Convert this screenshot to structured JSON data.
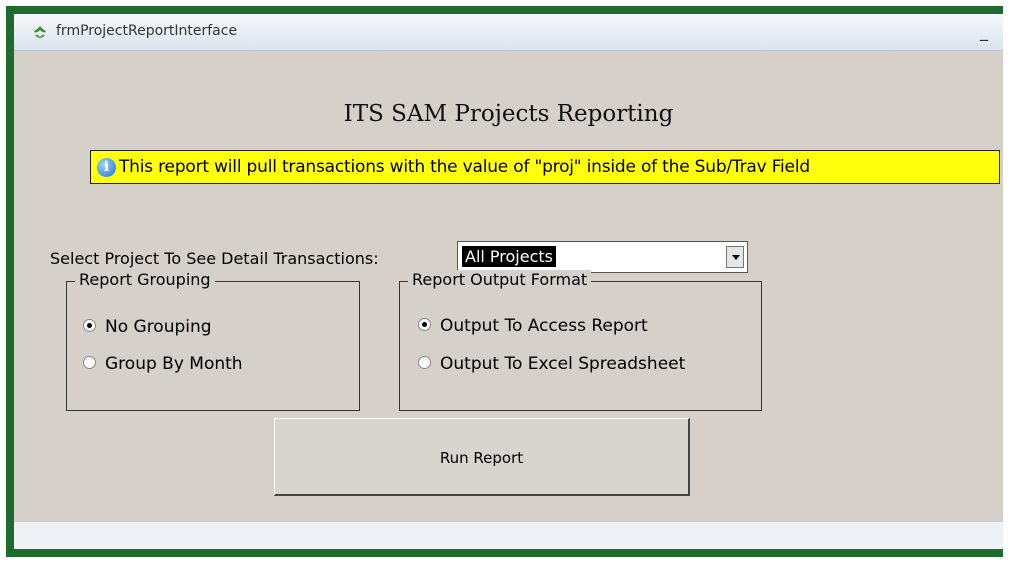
{
  "window": {
    "title": "frmProjectReportInterface",
    "minimize_glyph": "_"
  },
  "form": {
    "heading": "ITS SAM Projects Reporting",
    "info_text": "This report will pull transactions with the value of \"proj\" inside of the Sub/Trav Field",
    "select_label": "Select Project To See Detail Transactions:",
    "project_select": {
      "selected": "All Projects"
    }
  },
  "report_grouping": {
    "title": "Report Grouping",
    "options": [
      {
        "label": "No Grouping",
        "checked": true
      },
      {
        "label": "Group By Month",
        "checked": false
      }
    ]
  },
  "output_format": {
    "title": "Report Output Format",
    "options": [
      {
        "label": "Output To Access Report",
        "checked": true
      },
      {
        "label": "Output To Excel Spreadsheet",
        "checked": false
      }
    ]
  },
  "run_button": {
    "label": "Run Report"
  },
  "icons": {
    "app": "access-form-icon",
    "info": "info-icon"
  },
  "colors": {
    "frame": "#1e6b2e",
    "banner": "#ffff0e",
    "client": "#d5d0ca"
  }
}
